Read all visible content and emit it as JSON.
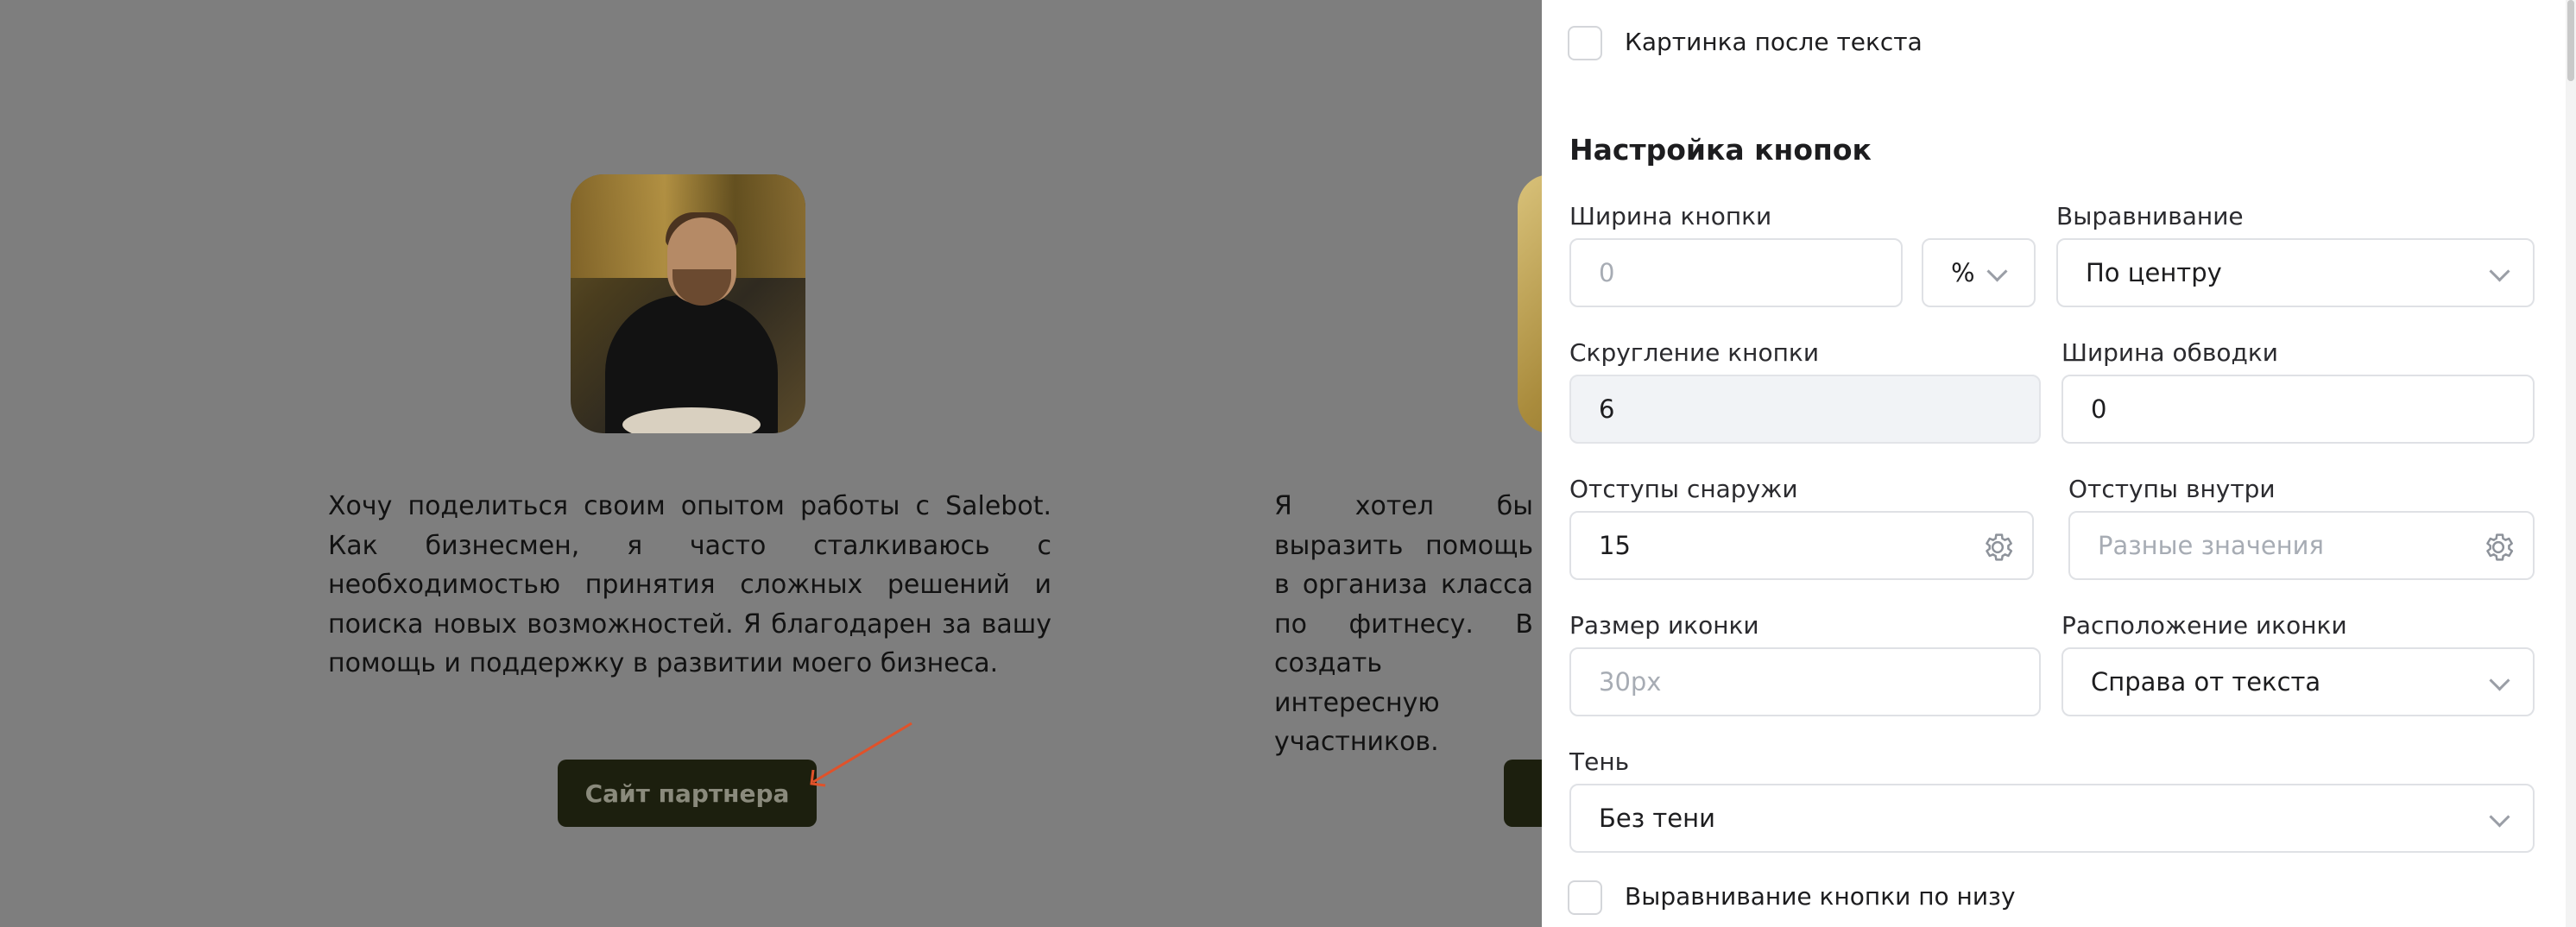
{
  "preview": {
    "cards": [
      {
        "quote": "Хочу поделиться своим опытом работы с Salebot. Как бизнесмен, я часто сталкиваюсь с необходимостью принятия сложных решений и поиска новых возможностей. Я благодарен за вашу помощь и поддержку в развитии моего бизнеса.",
        "button_label": "Сайт партнера"
      },
      {
        "quote": "Я хотел бы выразить помощь в организа класса по фитнесу. В создать интересную участников.",
        "button_label": ""
      }
    ]
  },
  "panel": {
    "image_after_text_label": "Картинка после текста",
    "section_title": "Настройка кнопок",
    "button_width": {
      "label": "Ширина кнопки",
      "placeholder": "0",
      "unit": "%"
    },
    "alignment": {
      "label": "Выравнивание",
      "value": "По центру"
    },
    "button_radius": {
      "label": "Скругление кнопки",
      "value": "6"
    },
    "border_width": {
      "label": "Ширина обводки",
      "value": "0"
    },
    "outer_padding": {
      "label": "Отступы снаружи",
      "value": "15"
    },
    "inner_padding": {
      "label": "Отступы внутри",
      "placeholder": "Разные значения"
    },
    "icon_size": {
      "label": "Размер иконки",
      "placeholder": "30px"
    },
    "icon_position": {
      "label": "Расположение иконки",
      "value": "Справа от текста"
    },
    "shadow": {
      "label": "Тень",
      "value": "Без тени"
    },
    "align_bottom_label": "Выравнивание кнопки по низу"
  },
  "colors": {
    "overlay": "#7e7e7e",
    "panel_bg": "#ffffff",
    "partner_button": "#1c1f0e",
    "arrow": "#e0522a",
    "border": "#dfe1e5"
  },
  "icons": [
    "gear-icon",
    "chevron-down-icon",
    "arrow-annotation-icon"
  ]
}
